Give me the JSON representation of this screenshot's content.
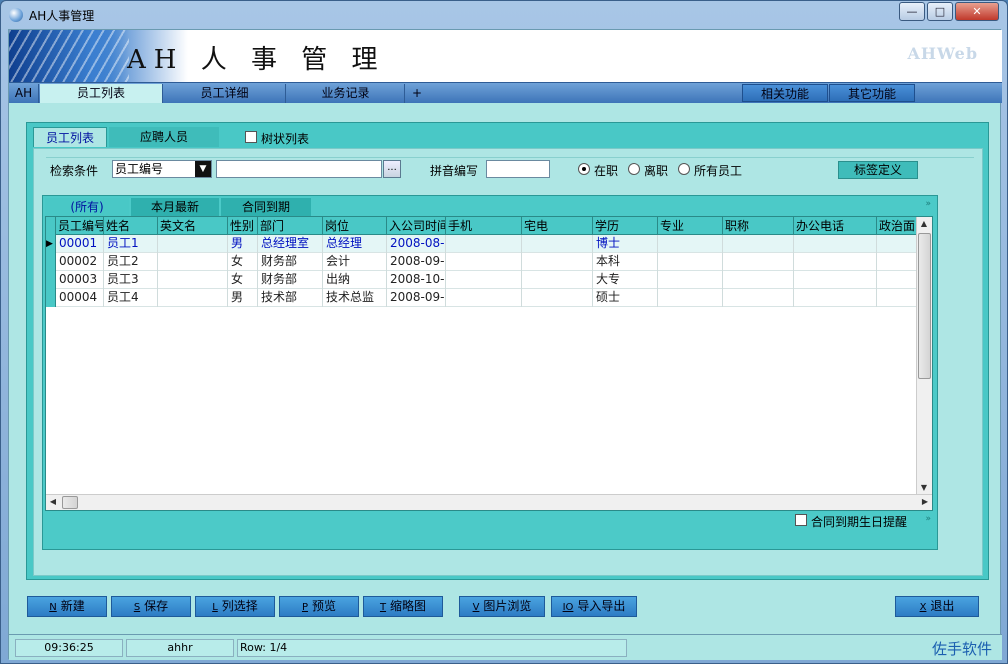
{
  "window": {
    "title": "AH人事管理",
    "controls": [
      "min",
      "max",
      "close"
    ]
  },
  "banner": {
    "title": "AH 人 事 管 理",
    "brand": "AHWeb"
  },
  "nav": {
    "home": "AH",
    "tabs": [
      "员工列表",
      "员工详细",
      "业务记录",
      "+"
    ],
    "right": [
      "相关功能",
      "其它功能"
    ]
  },
  "panel_tabs": [
    "员工列表",
    "应聘人员"
  ],
  "tree_view_label": "树状列表",
  "search": {
    "condition_label": "检索条件",
    "field_value": "员工编号",
    "input_value": "",
    "browse_label": "...",
    "pinyin_label": "拼音编写",
    "pinyin_value": "",
    "radios": [
      "在职",
      "离职",
      "所有员工"
    ],
    "radio_selected": "在职",
    "tag_button": "标签定义"
  },
  "grid_tabs": [
    "(所有)",
    "本月最新",
    "合同到期"
  ],
  "grid": {
    "columns": [
      "员工编号",
      "姓名",
      "英文名",
      "性别",
      "部门",
      "岗位",
      "入公司时间",
      "手机",
      "宅电",
      "学历",
      "专业",
      "职称",
      "办公电话",
      "政治面"
    ],
    "rows": [
      [
        "00001",
        "员工1",
        "",
        "男",
        "总经理室",
        "总经理",
        "2008-08-",
        "",
        "",
        "博士",
        "",
        "",
        "",
        ""
      ],
      [
        "00002",
        "员工2",
        "",
        "女",
        "财务部",
        "会计",
        "2008-09-",
        "",
        "",
        "本科",
        "",
        "",
        "",
        ""
      ],
      [
        "00003",
        "员工3",
        "",
        "女",
        "财务部",
        "出纳",
        "2008-10-",
        "",
        "",
        "大专",
        "",
        "",
        "",
        ""
      ],
      [
        "00004",
        "员工4",
        "",
        "男",
        "技术部",
        "技术总监",
        "2008-09-",
        "",
        "",
        "硕士",
        "",
        "",
        "",
        ""
      ]
    ],
    "selected_row": 0
  },
  "reminder": "合同到期生日提醒",
  "buttons": [
    {
      "key": "N",
      "label": "新建"
    },
    {
      "key": "S",
      "label": "保存"
    },
    {
      "key": "L",
      "label": "列选择"
    },
    {
      "key": "P",
      "label": "预览"
    },
    {
      "key": "T",
      "label": "缩略图"
    },
    {
      "key": "V",
      "label": "图片浏览"
    },
    {
      "key": "IO",
      "label": "导入导出"
    },
    {
      "key": "X",
      "label": "退出"
    }
  ],
  "status": {
    "time": "09:36:25",
    "user": "ahhr",
    "row": "Row: 1/4",
    "company": "佐手软件"
  },
  "colors": {
    "teal": "#49c8c6",
    "light_teal": "#aee6e4",
    "blue_button": "#2d7cc4",
    "selected_text": "#0010c0"
  }
}
